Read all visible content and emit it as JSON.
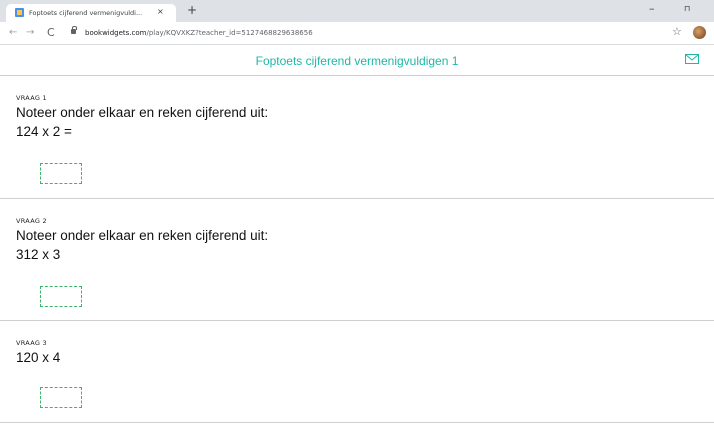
{
  "browser": {
    "tab_title": "Foptoets cijferend vermenigvuldi...",
    "tab_close": "×",
    "new_tab": "+",
    "win_minimize": "–",
    "win_restore": "⊓",
    "nav_back": "←",
    "nav_forward": "→",
    "nav_reload": "C",
    "url_host": "bookwidgets.com",
    "url_path": "/play/KQVXKZ?teacher_id=5127468829638656",
    "star": "☆"
  },
  "page": {
    "title": "Foptoets cijferend vermenigvuldigen 1",
    "accent_color": "#1fb7a5",
    "answer_box_color": "#3ab56a"
  },
  "questions": [
    {
      "label": "VRAAG 1",
      "lines": [
        "Noteer onder elkaar en reken cijferend uit:",
        "124 x 2 ="
      ]
    },
    {
      "label": "VRAAG 2",
      "lines": [
        "Noteer onder elkaar en reken cijferend uit:",
        "312 x 3"
      ]
    },
    {
      "label": "VRAAG 3",
      "lines": [
        "120 x 4"
      ]
    }
  ]
}
